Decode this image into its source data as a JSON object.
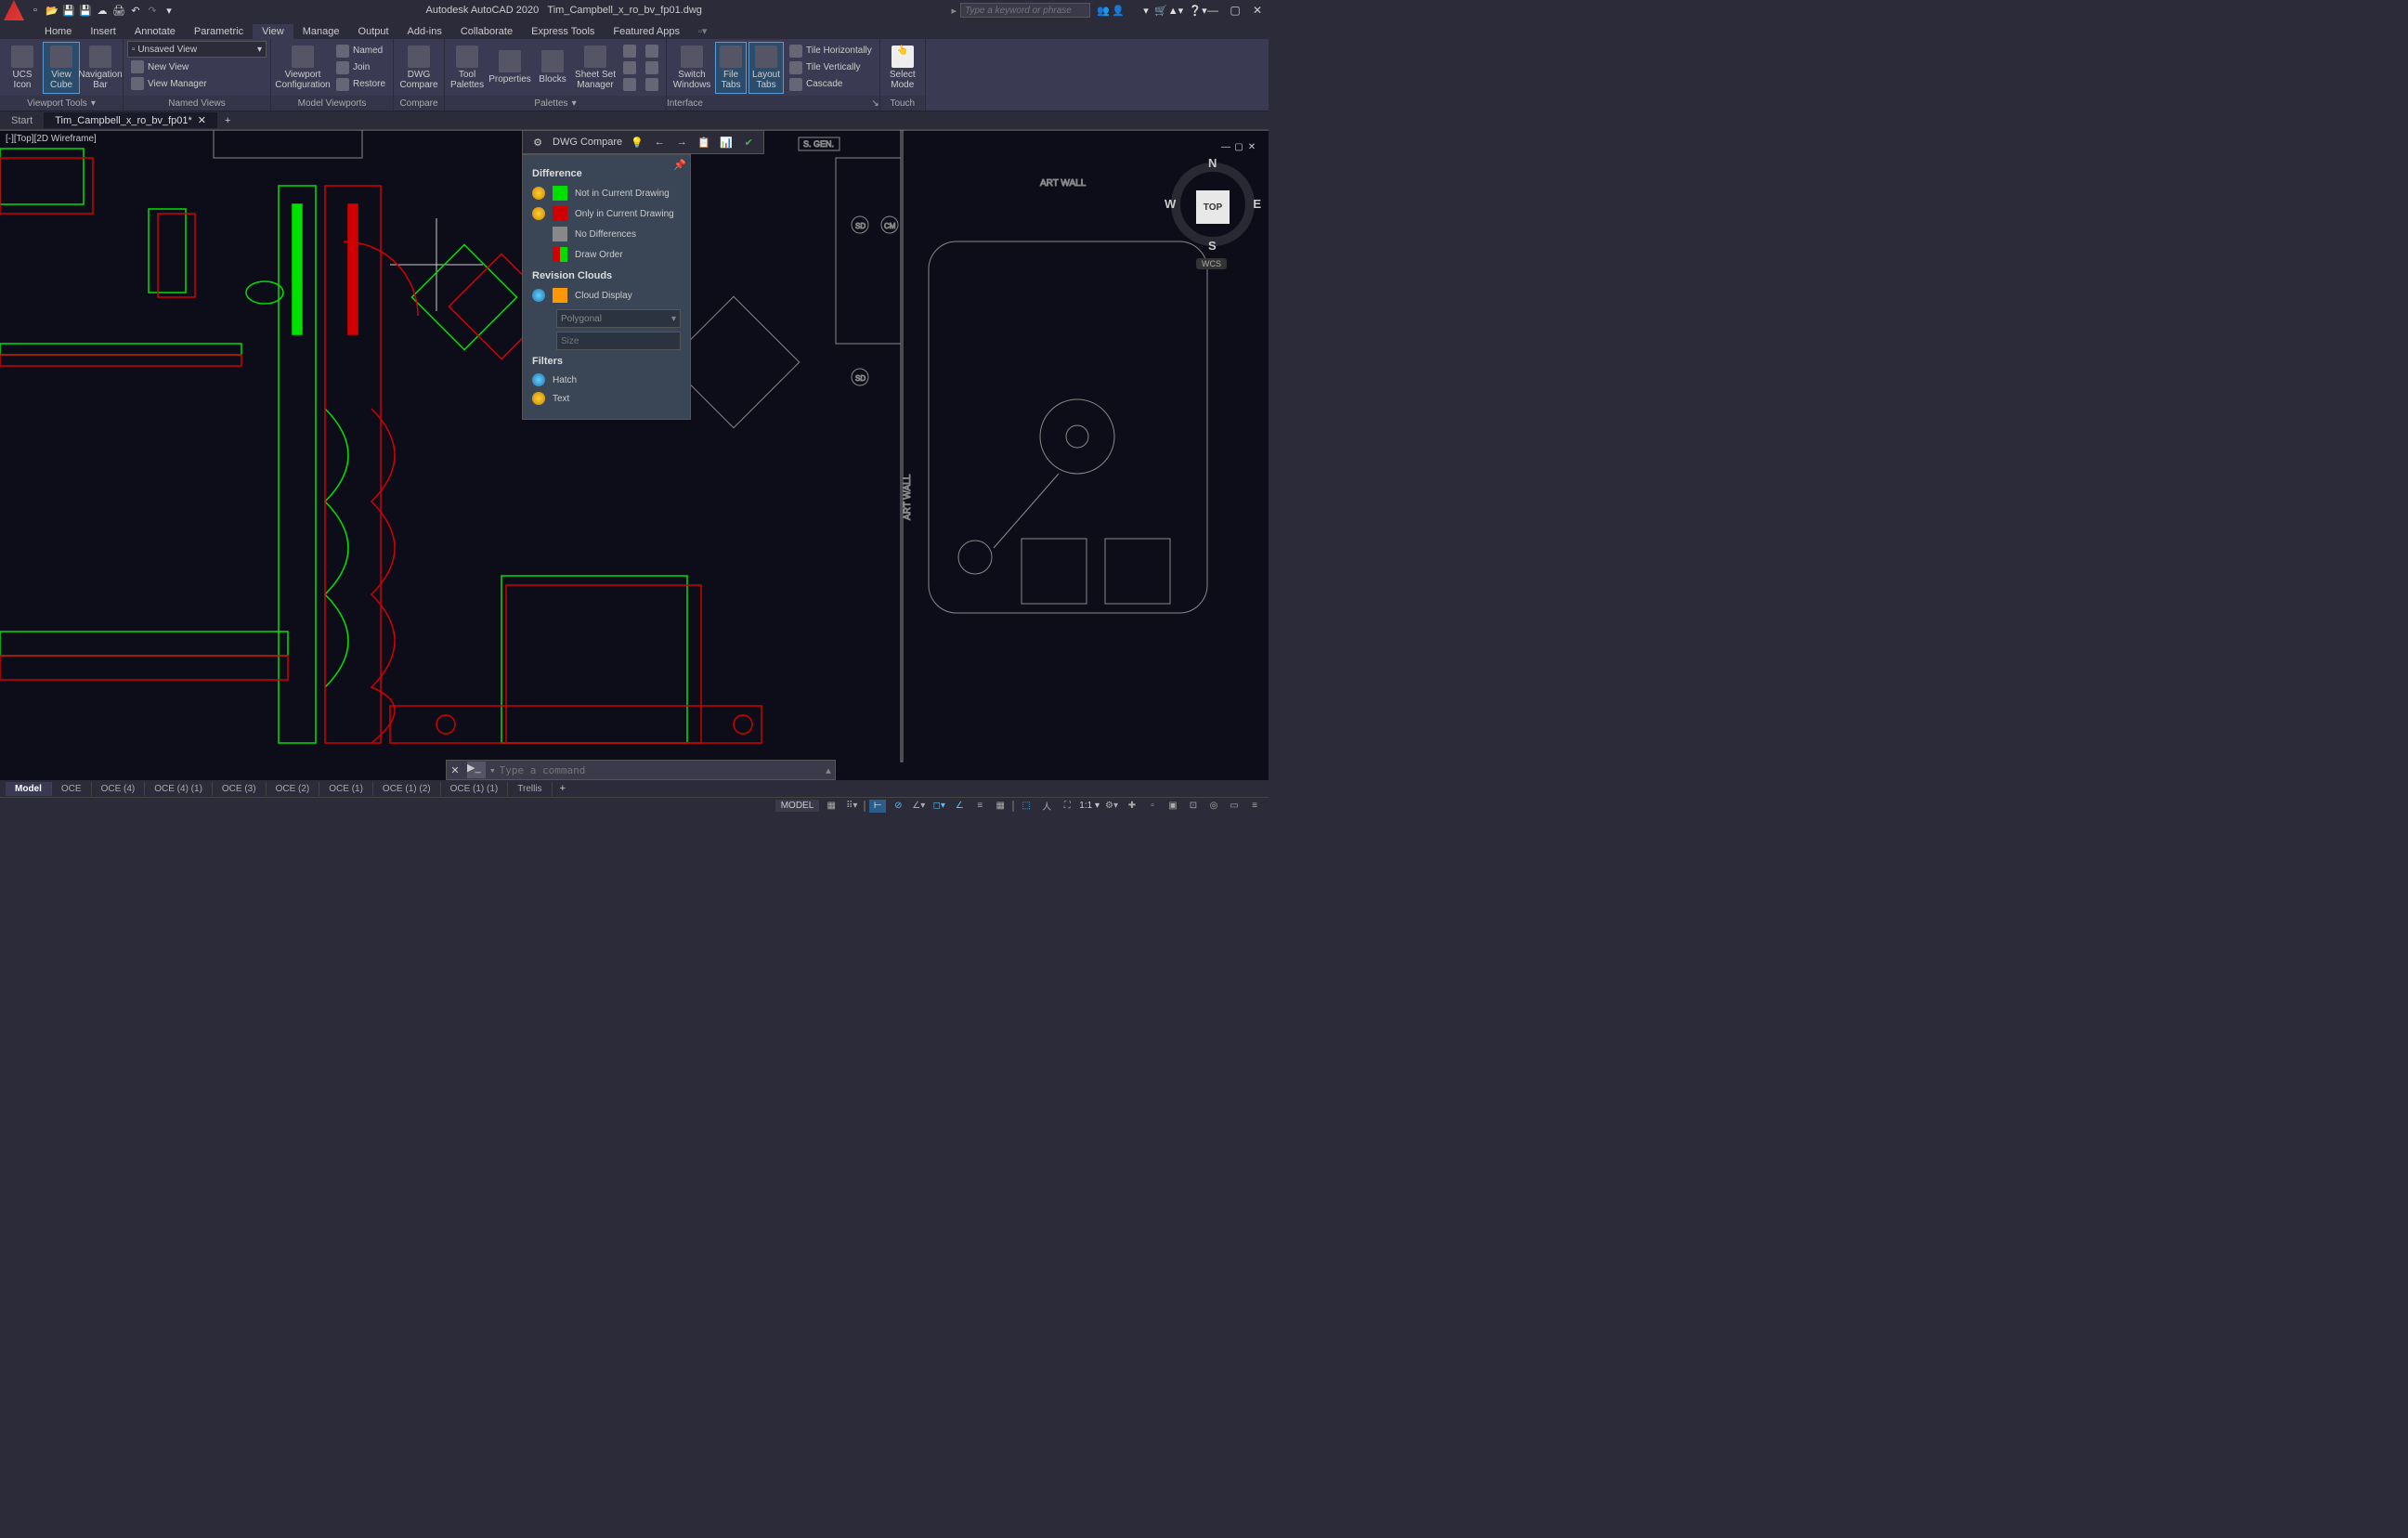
{
  "titlebar": {
    "app_name": "Autodesk AutoCAD 2020",
    "filename": "Tim_Campbell_x_ro_bv_fp01.dwg",
    "search_placeholder": "Type a keyword or phrase"
  },
  "menutabs": [
    "Home",
    "Insert",
    "Annotate",
    "Parametric",
    "View",
    "Manage",
    "Output",
    "Add-ins",
    "Collaborate",
    "Express Tools",
    "Featured Apps"
  ],
  "active_menutab": "View",
  "ribbon": {
    "viewport_tools": {
      "title": "Viewport Tools",
      "ucs_icon": "UCS\nIcon",
      "view_cube": "View\nCube",
      "nav_bar": "Navigation\nBar"
    },
    "named_views": {
      "title": "Named Views",
      "dropdown": "Unsaved View",
      "new_view": "New View",
      "view_manager": "View Manager"
    },
    "model_viewports": {
      "title": "Model Viewports",
      "viewport_config": "Viewport\nConfiguration",
      "named": "Named",
      "join": "Join",
      "restore": "Restore"
    },
    "compare": {
      "title": "Compare",
      "dwg_compare": "DWG\nCompare"
    },
    "palettes": {
      "title": "Palettes",
      "tool_palettes": "Tool\nPalettes",
      "properties": "Properties",
      "blocks": "Blocks",
      "sheet_set": "Sheet Set\nManager"
    },
    "interface": {
      "title": "Interface",
      "switch_windows": "Switch\nWindows",
      "file_tabs": "File\nTabs",
      "layout_tabs": "Layout\nTabs",
      "tile_horiz": "Tile Horizontally",
      "tile_vert": "Tile Vertically",
      "cascade": "Cascade"
    },
    "touch": {
      "title": "Touch",
      "select_mode": "Select\nMode"
    }
  },
  "file_tabs": {
    "start": "Start",
    "active": "Tim_Campbell_x_ro_bv_fp01*"
  },
  "canvas": {
    "view_label": "[-][Top][2D Wireframe]",
    "annotations": {
      "art_wall": "ART WALL",
      "s_gen": "S. GEN.",
      "sd": "SD",
      "cm": "CM"
    },
    "viewcube": {
      "top": "TOP",
      "n": "N",
      "s": "S",
      "e": "E",
      "w": "W",
      "wcs": "WCS"
    }
  },
  "compare_toolbar": {
    "label": "DWG Compare"
  },
  "compare_panel": {
    "sections": {
      "difference": "Difference",
      "revision_clouds": "Revision Clouds",
      "filters": "Filters"
    },
    "rows": {
      "not_in_current": "Not in Current Drawing",
      "only_in_current": "Only in Current Drawing",
      "no_differences": "No Differences",
      "draw_order": "Draw Order",
      "cloud_display": "Cloud Display",
      "shape_dropdown": "Polygonal",
      "size_label": "Size",
      "hatch": "Hatch",
      "text": "Text"
    }
  },
  "cmdline": {
    "placeholder": "Type a command"
  },
  "layout_tabs": [
    "Model",
    "OCE",
    "OCE (4)",
    "OCE (4) (1)",
    "OCE (3)",
    "OCE (2)",
    "OCE (1)",
    "OCE (1) (2)",
    "OCE (1) (1)",
    "Trellis"
  ],
  "active_layout": "Model",
  "statusbar": {
    "model_label": "MODEL",
    "scale": "1:1"
  }
}
